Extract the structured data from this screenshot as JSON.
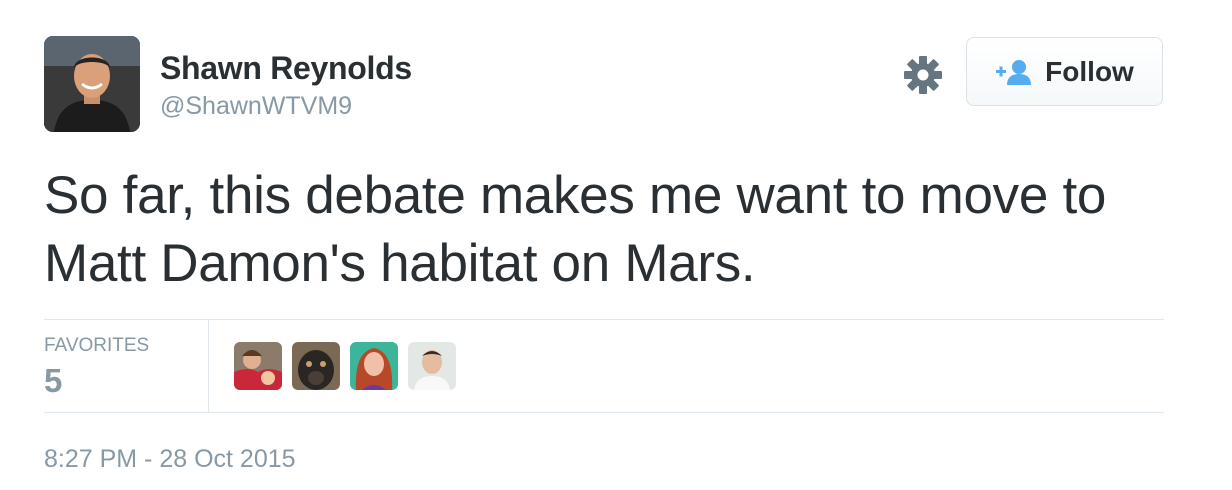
{
  "user": {
    "display_name": "Shawn Reynolds",
    "handle": "@ShawnWTVM9"
  },
  "follow_button": {
    "label": "Follow",
    "icon": "add-user-icon",
    "icon_color": "#55acee"
  },
  "settings_icon": "gear-icon",
  "tweet": {
    "text": "So far, this debate makes me want to move to Matt Damon's habitat on Mars."
  },
  "stats": {
    "favorites_label": "FAVORITES",
    "favorites_count": "5"
  },
  "favorited_by_avatars": 4,
  "timestamp": "8:27 PM - 28 Oct 2015",
  "colors": {
    "text_primary": "#292f33",
    "text_secondary": "#8899a6",
    "border": "#e1e8ed",
    "accent": "#55acee"
  }
}
